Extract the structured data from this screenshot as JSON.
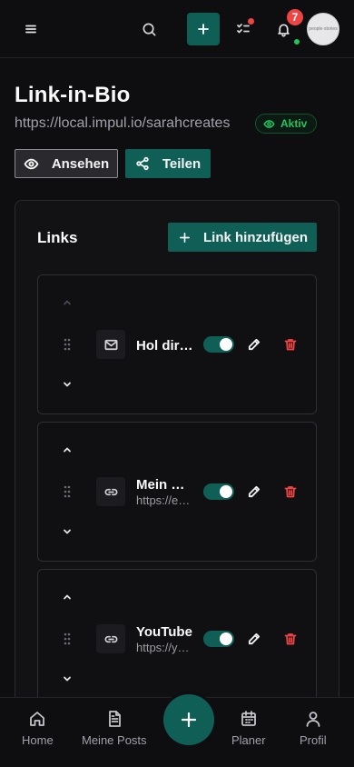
{
  "topbar": {
    "menu_icon": "menu-icon",
    "search_icon": "search-icon",
    "create_icon": "plus-icon",
    "tasks_icon": "list-check-icon",
    "notifications_icon": "bell-icon",
    "notification_count": "7",
    "avatar_text": "people·stories"
  },
  "header": {
    "title": "Link-in-Bio",
    "url": "https://local.impul.io/sarahcreates",
    "status": "Aktiv",
    "view_label": "Ansehen",
    "share_label": "Teilen"
  },
  "links": {
    "heading": "Links",
    "add_label": "Link hinzufügen",
    "items": [
      {
        "title": "Hol dir mein Freebie",
        "url": "",
        "icon": "mail-icon",
        "enabled": true
      },
      {
        "title": "Mein Coaching",
        "url": "https://example.com",
        "icon": "link-icon",
        "enabled": true
      },
      {
        "title": "YouTube",
        "url": "https://youtube.com",
        "icon": "link-icon",
        "enabled": true
      }
    ]
  },
  "bottom_nav": {
    "home": "Home",
    "posts": "Meine Posts",
    "planner": "Planer",
    "profile": "Profil"
  },
  "colors": {
    "accent": "#0f5f57",
    "danger": "#ef4444",
    "success": "#22c55e",
    "background": "#0e0e11"
  }
}
